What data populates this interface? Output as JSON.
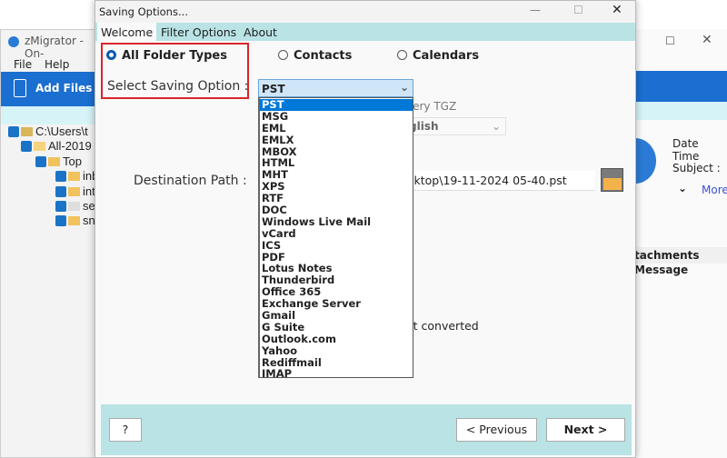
{
  "bg_window": {
    "title": "zMigrator - On-",
    "menu": [
      "File",
      "Help"
    ],
    "add_files": "Add Files",
    "tree": [
      "C:\\Users\\t",
      "All-2019",
      "Top",
      "inb",
      "int",
      "se",
      "sn"
    ]
  },
  "right_window": {
    "date_time": "Date Time",
    "subject": "Subject :",
    "more": "More",
    "attachments": "tachments",
    "message": "Message"
  },
  "dialog": {
    "title": "Saving Options...",
    "tabs": [
      "Welcome",
      "Filter Options",
      "About"
    ],
    "radios": [
      "All Folder Types",
      "Contacts",
      "Calendars"
    ],
    "select_label": "Select Saving Option :",
    "select_value": "PST",
    "options": [
      "PST",
      "MSG",
      "EML",
      "EMLX",
      "MBOX",
      "HTML",
      "MHT",
      "XPS",
      "RTF",
      "DOC",
      "Windows Live Mail",
      "vCard",
      "ICS",
      "PDF",
      "Lotus Notes",
      "Thunderbird",
      "Office 365",
      "Exchange Server",
      "Gmail",
      "G Suite",
      "Outlook.com",
      "Yahoo",
      "Rediffmail",
      "IMAP"
    ],
    "hidden_text_1": "very TGZ",
    "language_value": "glish",
    "destination_label": "Destination Path :",
    "destination_value": "sktop\\19-11-2024 05-40.pst",
    "hidden_text_2": "ot converted",
    "help_button": "?",
    "previous_button": "<  Previous",
    "next_button": "Next >"
  },
  "colors": {
    "accent": "#0078d7",
    "teal": "#b9e3e5",
    "highlight_border": "#d9262c"
  }
}
